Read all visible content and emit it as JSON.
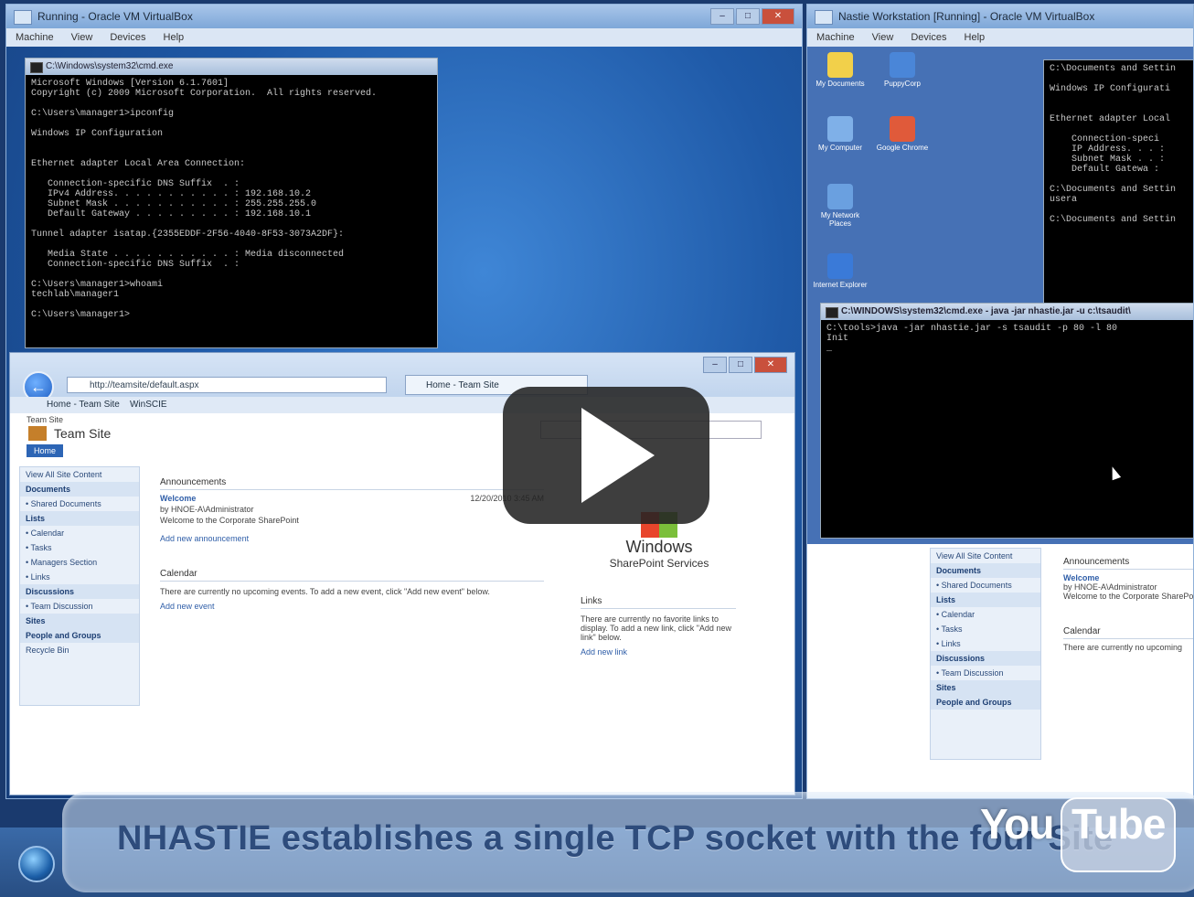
{
  "left_vm": {
    "title": "Running - Oracle VM VirtualBox",
    "menu": [
      "Machine",
      "View",
      "Devices",
      "Help"
    ]
  },
  "cmd_left": {
    "title": "C:\\Windows\\system32\\cmd.exe",
    "lines": [
      "Microsoft Windows [Version 6.1.7601]",
      "Copyright (c) 2009 Microsoft Corporation.  All rights reserved.",
      "",
      "C:\\Users\\manager1>ipconfig",
      "",
      "Windows IP Configuration",
      "",
      "",
      "Ethernet adapter Local Area Connection:",
      "",
      "   Connection-specific DNS Suffix  . :",
      "   IPv4 Address. . . . . . . . . . . : 192.168.10.2",
      "   Subnet Mask . . . . . . . . . . . : 255.255.255.0",
      "   Default Gateway . . . . . . . . . : 192.168.10.1",
      "",
      "Tunnel adapter isatap.{2355EDDF-2F56-4040-8F53-3073A2DF}:",
      "",
      "   Media State . . . . . . . . . . . : Media disconnected",
      "   Connection-specific DNS Suffix  . :",
      "",
      "C:\\Users\\manager1>whoami",
      "techlab\\manager1",
      "",
      "C:\\Users\\manager1>"
    ]
  },
  "ie": {
    "address": "http://teamsite/default.aspx",
    "tab": "Home - Team Site",
    "favorites": [
      "Home - Team Site",
      "WinSCIE"
    ],
    "site_title": "Team Site",
    "tab_home": "Home",
    "breadcrumb": "Team Site",
    "quicklaunch": [
      {
        "text": "View All Site Content",
        "head": false
      },
      {
        "text": "Documents",
        "head": true
      },
      {
        "text": "• Shared Documents",
        "head": false
      },
      {
        "text": "Lists",
        "head": true
      },
      {
        "text": "• Calendar",
        "head": false
      },
      {
        "text": "• Tasks",
        "head": false
      },
      {
        "text": "• Managers Section",
        "head": false
      },
      {
        "text": "• Links",
        "head": false
      },
      {
        "text": "Discussions",
        "head": true
      },
      {
        "text": "• Team Discussion",
        "head": false
      },
      {
        "text": "Sites",
        "head": true
      },
      {
        "text": "People and Groups",
        "head": true
      },
      {
        "text": "Recycle Bin",
        "head": false
      }
    ],
    "announcements_title": "Announcements",
    "announcement_heading": "Welcome",
    "announcement_by": "by HNOE-A\\Administrator",
    "announcement_date": "12/20/2010 3:45 AM",
    "announcement_body": "Welcome to the Corporate SharePoint",
    "add_announcement": "Add new announcement",
    "calendar_title": "Calendar",
    "calendar_body": "There are currently no upcoming events. To add a new event, click \"Add new event\" below.",
    "add_event": "Add new event",
    "links_title": "Links",
    "links_body": "There are currently no favorite links to display. To add a new link, click \"Add new link\" below.",
    "add_link": "Add new link",
    "wss_logo_1": "Windows",
    "wss_logo_2": "SharePoint Services"
  },
  "right_vm": {
    "title": "Nastie Workstation [Running] - Oracle VM VirtualBox",
    "menu": [
      "Machine",
      "View",
      "Devices",
      "Help"
    ],
    "icons": [
      {
        "label": "My Documents",
        "color": "#f2d04a"
      },
      {
        "label": "PuppyCorp",
        "color": "#4a86d8"
      },
      {
        "label": "My Computer",
        "color": "#7fb0e8"
      },
      {
        "label": "Google Chrome",
        "color": "#e05a3a"
      },
      {
        "label": "My Network Places",
        "color": "#6aa0e0"
      },
      {
        "label": "Internet Explorer",
        "color": "#3a7ad8"
      }
    ],
    "cmd_back_lines": [
      "C:\\Documents and Settin",
      "",
      "Windows IP Configurati",
      "",
      "",
      "Ethernet adapter Local",
      "",
      "    Connection-speci",
      "    IP Address. . . :",
      "    Subnet Mask . . :",
      "    Default Gatewa :",
      "",
      "C:\\Documents and Settin",
      "usera",
      "",
      "C:\\Documents and Settin"
    ],
    "cmd_front_title": "C:\\WINDOWS\\system32\\cmd.exe - java -jar nhastie.jar -u c:\\tsaudit\\",
    "cmd_front_lines": [
      "C:\\tools>java -jar nhastie.jar -s tsaudit -p 80 -l 80",
      "Init",
      "_"
    ],
    "sp_quicklaunch": [
      {
        "text": "View All Site Content",
        "head": false
      },
      {
        "text": "Documents",
        "head": true
      },
      {
        "text": "• Shared Documents",
        "head": false
      },
      {
        "text": "Lists",
        "head": true
      },
      {
        "text": "• Calendar",
        "head": false
      },
      {
        "text": "• Tasks",
        "head": false
      },
      {
        "text": "• Links",
        "head": false
      },
      {
        "text": "Discussions",
        "head": true
      },
      {
        "text": "• Team Discussion",
        "head": false
      },
      {
        "text": "Sites",
        "head": true
      },
      {
        "text": "People and Groups",
        "head": true
      }
    ],
    "sp_announcements": "Announcements",
    "sp_welcome": "Welcome",
    "sp_by": "by HNOE-A\\Administrator",
    "sp_body": "Welcome to the Corporate SharePoint",
    "sp_calendar": "Calendar",
    "sp_calendar_body": "There are currently no upcoming"
  },
  "caption": "NHASTIE establishes a single TCP socket with the four Site",
  "youtube": {
    "you": "You",
    "tube": "Tube"
  }
}
